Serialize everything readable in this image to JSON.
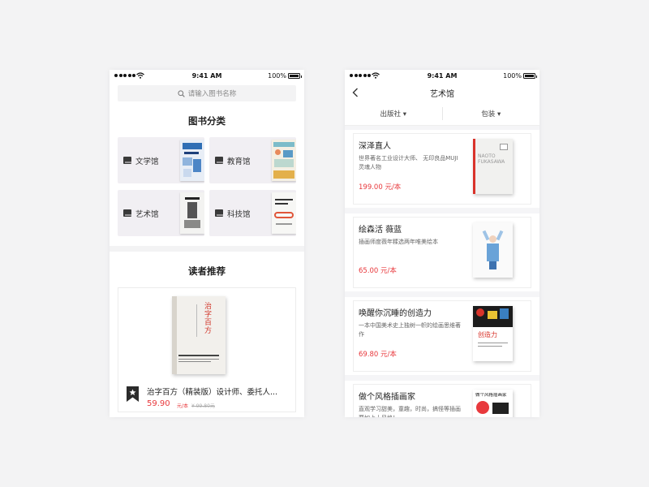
{
  "status_bar": {
    "time": "9:41 AM",
    "battery": "100%"
  },
  "home": {
    "search_placeholder": "请输入图书名称",
    "categories_title": "图书分类",
    "categories": [
      {
        "label": "文学馆",
        "icon": "book-icon"
      },
      {
        "label": "教育馆",
        "icon": "book-icon"
      },
      {
        "label": "艺术馆",
        "icon": "book-icon"
      },
      {
        "label": "科技馆",
        "icon": "book-icon"
      }
    ],
    "recommend_title": "读者推荐",
    "recommend": {
      "name": "治字百方（精装版）设计师、委托人...",
      "price": "59.90",
      "unit": "元/本",
      "old_price": "¥ 99.80元",
      "cover_title": "治字百方"
    }
  },
  "art": {
    "title": "艺术馆",
    "filters": [
      "出版社 ▾",
      "包装 ▾"
    ],
    "items": [
      {
        "name": "深泽直人",
        "desc": "世界著名工业设计大师、 无印良品MUJI灵魂人物",
        "price": "199.00 元/本",
        "cover_text": "NAOTO FUKASAWA"
      },
      {
        "name": "绘森活 薇蓝",
        "desc": "插画师度薇年糅选两年唯美绘本",
        "price": "65.00 元/本",
        "cover_text": ""
      },
      {
        "name": "唤醒你沉睡的创造力",
        "desc": "一本中国美术史上独树一帜的绘画思维著作",
        "price": "69.80 元/本",
        "cover_text": "创造力"
      },
      {
        "name": "做个风格插画家",
        "desc": "直观学习甜美，童趣，时尚，搞怪等插画要如上十风格！",
        "price": "",
        "cover_text": "做个风格插画家"
      }
    ]
  },
  "colors": {
    "price_red": "#e8393d",
    "tile_bg": "#f1eff3",
    "page_bg": "#f3f3f4"
  }
}
